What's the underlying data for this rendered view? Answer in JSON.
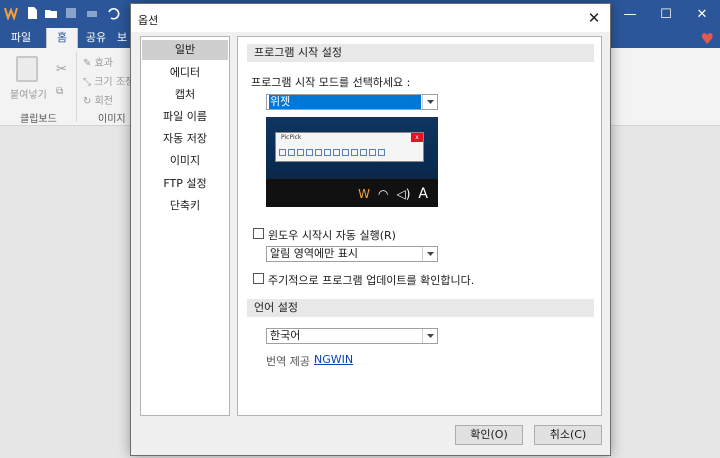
{
  "app": {
    "tabs": [
      "파일",
      "홈",
      "공유",
      "보"
    ],
    "ribbon_items": {
      "paste": "붙여넣기",
      "effect": "효과",
      "resize": "크기 조정",
      "rotate": "회전"
    },
    "groups": [
      "클립보드",
      "이미지"
    ]
  },
  "dialog": {
    "title": "옵션",
    "close_glyph": "✕",
    "nav": [
      "일반",
      "에디터",
      "캡처",
      "파일 이름",
      "자동 저장",
      "이미지",
      "FTP 설정",
      "단축키"
    ],
    "section_startup": "프로그램 시작 설정",
    "startup_mode_label": "프로그램 시작 모드를 선택하세요 :",
    "startup_mode_value": "위젯",
    "preview": {
      "window_title": "PicPick",
      "close": "x",
      "tray_text": "A"
    },
    "autostart_label": "윈도우 시작시 자동 실행(R)",
    "tray_option_value": "알림 영역에만 표시",
    "update_label": "주기적으로 프로그램 업데이트를 확인합니다.",
    "section_language": "언어 설정",
    "language_value": "한국어",
    "translation_prefix": "번역 제공 :",
    "translation_link": "NGWIN",
    "ok_button": "확인(O)",
    "cancel_button": "취소(C)"
  },
  "colors": {
    "titlebar": "#2b579a",
    "selection": "#0078d7",
    "link": "#0645ad"
  }
}
